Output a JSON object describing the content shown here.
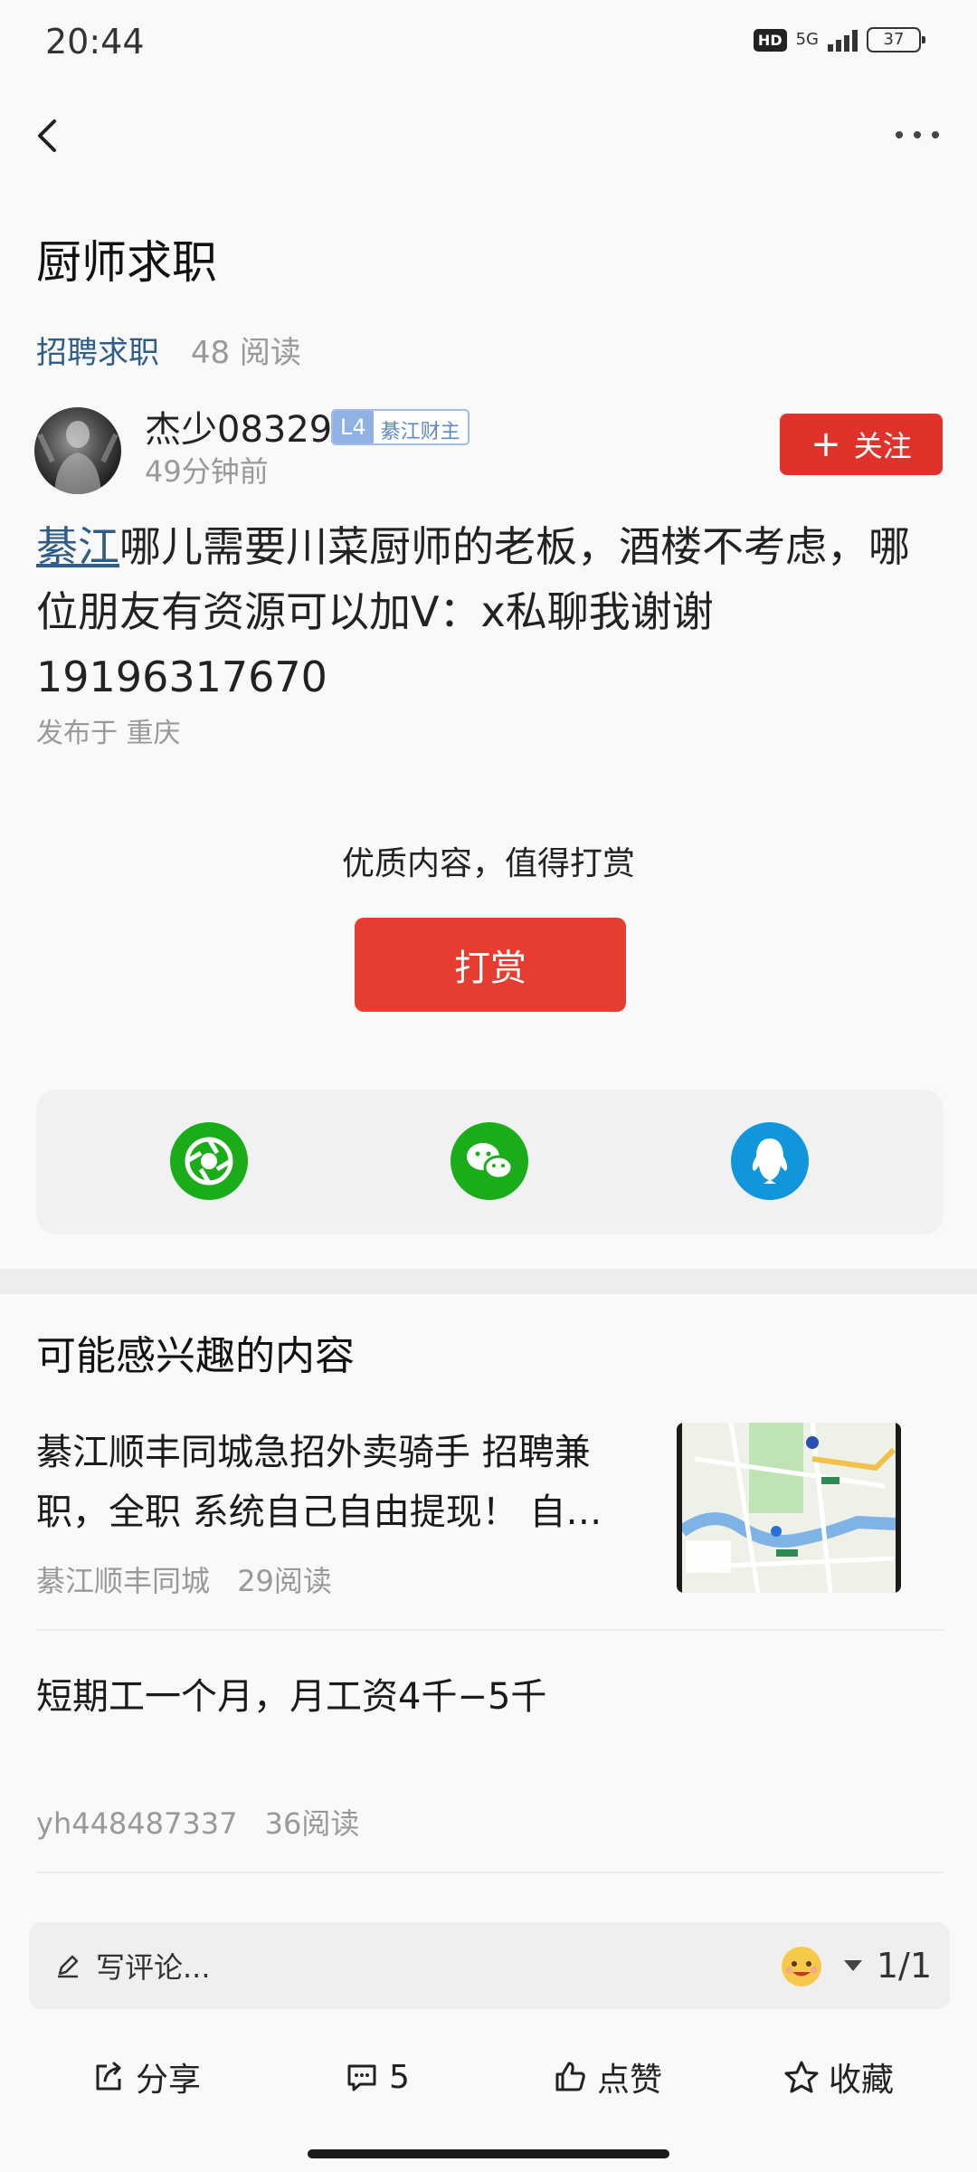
{
  "status_bar": {
    "time": "20:44",
    "hd": "HD",
    "network": "5G",
    "battery": "37"
  },
  "post": {
    "title": "厨师求职",
    "category": "招聘求职",
    "read_count": "48 阅读",
    "author": {
      "name": "杰少08329",
      "level": "L4",
      "badge": "綦江财主",
      "time_ago": "49分钟前"
    },
    "follow_label": "关注",
    "content_location": "綦江",
    "content_text": "哪儿需要川菜厨师的老板，酒楼不考虑，哪位朋友有资源可以加V：x私聊我谢谢19196317670",
    "published_at": "发布于 重庆"
  },
  "tip": {
    "text": "优质内容，值得打赏",
    "button_label": "打赏"
  },
  "share": {
    "icons": [
      "moments-icon",
      "wechat-icon",
      "qq-icon"
    ],
    "colors": {
      "moments": "#1aad19",
      "wechat": "#1aad19",
      "qq": "#1296db"
    }
  },
  "related": {
    "title": "可能感兴趣的内容",
    "items": [
      {
        "title": "綦江顺丰同城急招外卖骑手 招聘兼职，全职 系统自己自由提现！ 自…",
        "source": "綦江顺丰同城",
        "reads": "29阅读"
      },
      {
        "title": "短期工一个月，月工资4千−5千",
        "source": "yh448487337",
        "reads": "36阅读"
      }
    ]
  },
  "comment_bar": {
    "placeholder": "写评论...",
    "page": "1/1"
  },
  "actions": {
    "share": "分享",
    "comment_count": "5",
    "like": "点赞",
    "favorite": "收藏"
  },
  "colors": {
    "accent_red": "#e0322b",
    "link_blue": "#2f5d8a",
    "muted_gray": "#999999"
  }
}
